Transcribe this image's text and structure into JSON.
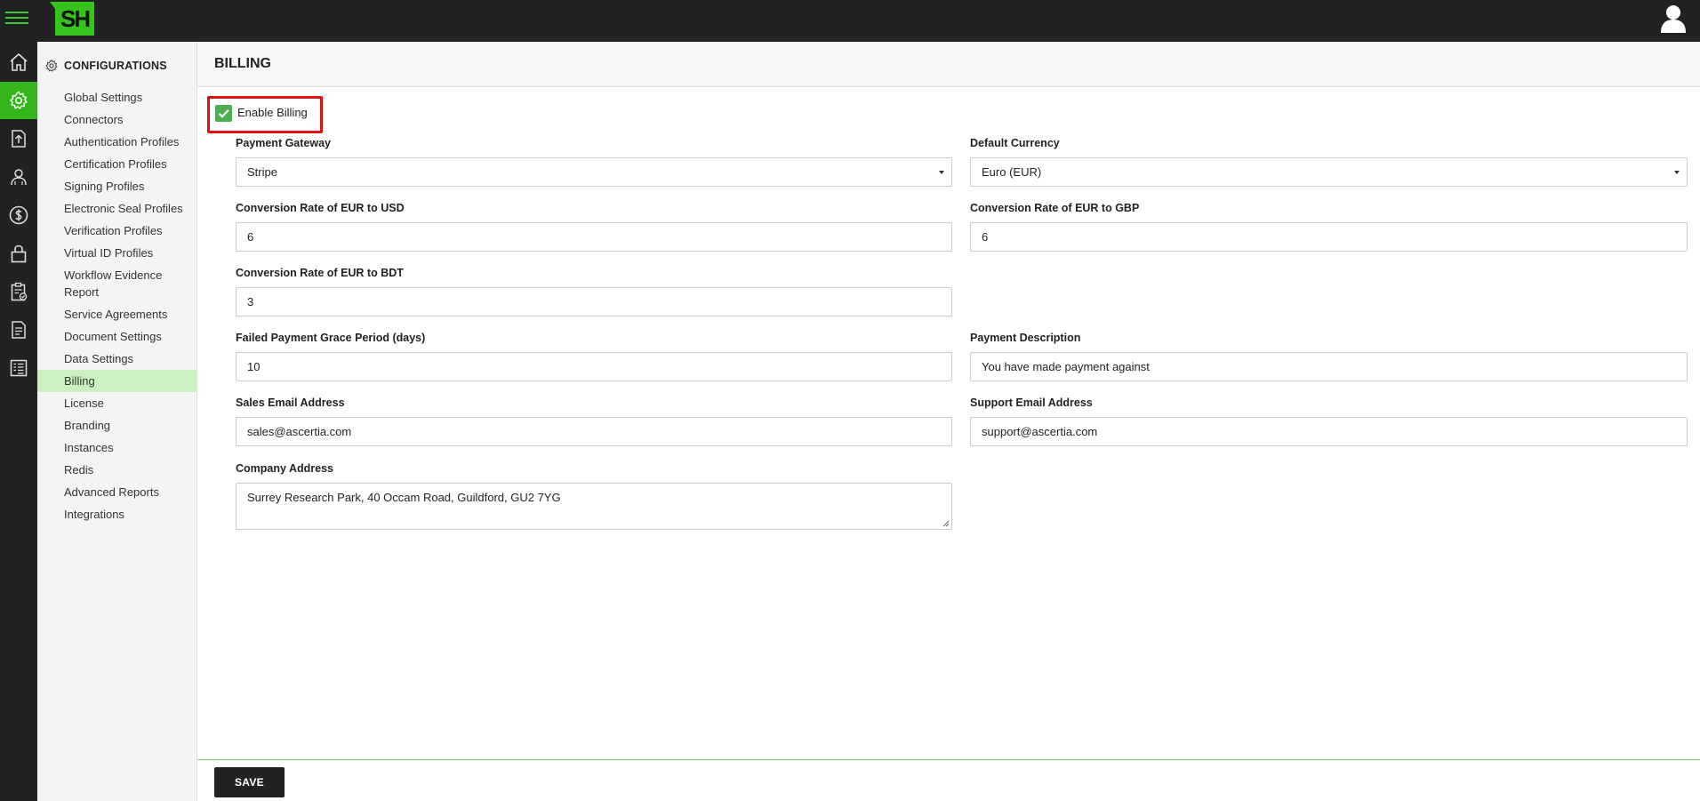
{
  "header": {
    "logo_text": "SH",
    "menu_icon": "hamburger-icon",
    "user_icon": "user-avatar-icon"
  },
  "icon_rail": [
    {
      "name": "home-icon",
      "active": false
    },
    {
      "name": "gear-icon",
      "active": true
    },
    {
      "name": "upload-document-icon",
      "active": false
    },
    {
      "name": "user-group-icon",
      "active": false
    },
    {
      "name": "dollar-icon",
      "active": false
    },
    {
      "name": "lock-icon",
      "active": false
    },
    {
      "name": "clipboard-check-icon",
      "active": false
    },
    {
      "name": "document-icon",
      "active": false
    },
    {
      "name": "report-icon",
      "active": false
    }
  ],
  "sidebar": {
    "section_title": "CONFIGURATIONS",
    "items": [
      {
        "label": "Global Settings"
      },
      {
        "label": "Connectors"
      },
      {
        "label": "Authentication Profiles"
      },
      {
        "label": "Certification Profiles"
      },
      {
        "label": "Signing Profiles"
      },
      {
        "label": "Electronic Seal Profiles"
      },
      {
        "label": "Verification Profiles"
      },
      {
        "label": "Virtual ID Profiles"
      },
      {
        "label": "Workflow Evidence Report"
      },
      {
        "label": "Service Agreements"
      },
      {
        "label": "Document Settings"
      },
      {
        "label": "Data Settings"
      },
      {
        "label": "Billing",
        "active": true
      },
      {
        "label": "License"
      },
      {
        "label": "Branding"
      },
      {
        "label": "Instances"
      },
      {
        "label": "Redis"
      },
      {
        "label": "Advanced Reports"
      },
      {
        "label": "Integrations"
      }
    ]
  },
  "page": {
    "title": "BILLING",
    "enable_billing": {
      "label": "Enable Billing",
      "checked": true
    },
    "fields": {
      "payment_gateway": {
        "label": "Payment Gateway",
        "value": "Stripe"
      },
      "default_currency": {
        "label": "Default Currency",
        "value": "Euro (EUR)"
      },
      "rate_usd": {
        "label": "Conversion Rate of EUR to USD",
        "value": "6"
      },
      "rate_gbp": {
        "label": "Conversion Rate of EUR to GBP",
        "value": "6"
      },
      "rate_bdt": {
        "label": "Conversion Rate of EUR to BDT",
        "value": "3"
      },
      "grace_period": {
        "label": "Failed Payment Grace Period (days)",
        "value": "10"
      },
      "payment_description": {
        "label": "Payment Description",
        "value": "You have made payment against"
      },
      "sales_email": {
        "label": "Sales Email Address",
        "value": "sales@ascertia.com"
      },
      "support_email": {
        "label": "Support Email Address",
        "value": "support@ascertia.com"
      },
      "company_address": {
        "label": "Company Address",
        "value": "Surrey Research Park, 40 Occam Road, Guildford, GU2 7YG"
      }
    },
    "save_label": "SAVE"
  },
  "colors": {
    "accent": "#35b51c",
    "highlight": "#e01010",
    "dark": "#222222"
  }
}
